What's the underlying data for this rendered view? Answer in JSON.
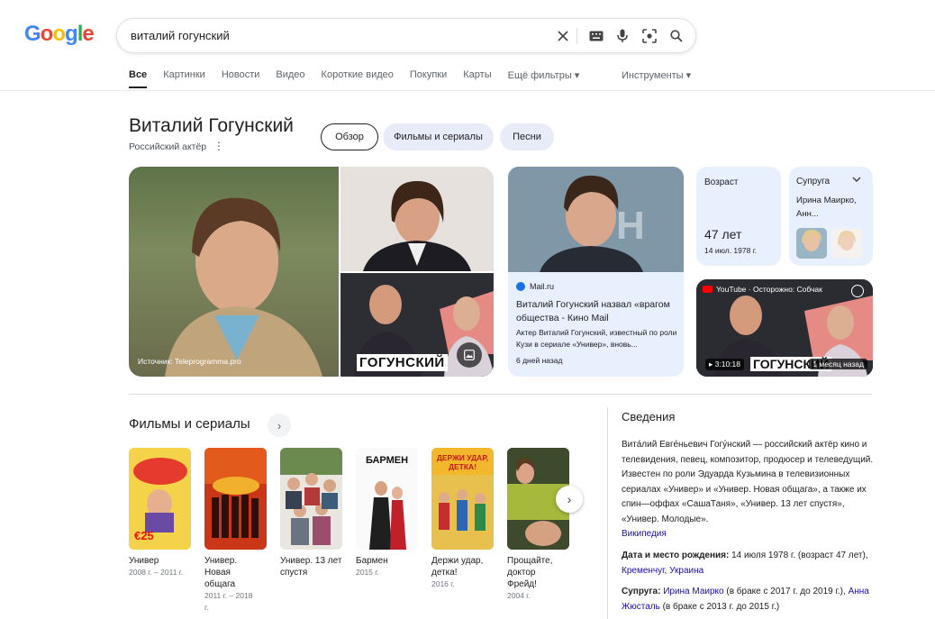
{
  "colors": {
    "accent": "#1a73e8",
    "link": "#1a0dab",
    "chip_bg": "#e8ecf8"
  },
  "search": {
    "query": "виталий гогунский"
  },
  "tabs": [
    "Все",
    "Картинки",
    "Новости",
    "Видео",
    "Короткие видео",
    "Покупки",
    "Карты",
    "Ещё фильтры"
  ],
  "tools_label": "Инструменты",
  "entity": {
    "title": "Виталий Гогунский",
    "subtitle": "Российский актёр",
    "chips": [
      "Обзор",
      "Фильмы и сериалы",
      "Песни"
    ]
  },
  "hero_caption": "Источник: Teleprogramma.pro",
  "hero_overlay": "ГОГУНСКИЙ",
  "news": {
    "source": "Mail.ru",
    "title": "Виталий Гогунский назвал «врагом общества - Кино Mail",
    "snippet": "Актер Виталий Гогунский, известный по роли Кузи в сериале «Универ», вновь...",
    "time": "6 дней назад"
  },
  "age_card": {
    "label": "Возраст",
    "value": "47 лет",
    "date": "14 июл. 1978 г."
  },
  "spouse_card": {
    "label": "Супруга",
    "names": "Ирина Маирко, Анн..."
  },
  "video": {
    "channel": "YouTube · Осторожно: Собчак",
    "duration": "3:10:18",
    "overlay": "ГОГУНСКИЙ",
    "age": "1 месяц назад"
  },
  "films_heading": "Фильмы и сериалы",
  "films": [
    {
      "title": "Универ",
      "year": "2008 г. – 2011 г."
    },
    {
      "title": "Универ. Новая общага",
      "year": "2011 г. – 2018 г."
    },
    {
      "title": "Универ. 13 лет спустя",
      "year": ""
    },
    {
      "title": "Бармен",
      "year": "2015 г."
    },
    {
      "title": "Держи удар, детка!",
      "year": "2016 г."
    },
    {
      "title": "Прощайте, доктор Фрейд!",
      "year": "2004 г."
    }
  ],
  "poster_texts": {
    "barmen": "БАРМЕН",
    "derzhi": "ДЕРЖИ УДАР, ДЕТКА!",
    "univer_num": "€25"
  },
  "about": {
    "heading": "Сведения",
    "text": "Вита́лий Евге́ньевич Гогу́нский — российский актёр кино и телевидения, певец, композитор, продюсер и телеведущий. Известен по роли Эдуарда Кузьмина в телевизионных сериалах «Универ» и «Универ. Новая общага», а также их спин—оффах «СашаТаня», «Универ. 13 лет спустя», «Универ. Молодые».",
    "wiki": "Википедия",
    "born_label": "Дата и место рождения:",
    "born_value": " 14 июля 1978 г. (возраст 47 лет), ",
    "born_city": "Кременчуг",
    "born_sep": ", ",
    "born_country": "Украина",
    "spouse_label": "Супруга:",
    "spouse1": "Ирина Маирко",
    "spouse1_note": " (в браке с 2017 г. до 2019 г.),",
    "spouse2": "Анна Жюсталь",
    "spouse2_note": " (в браке с 2013 г. до 2015 г.)"
  }
}
